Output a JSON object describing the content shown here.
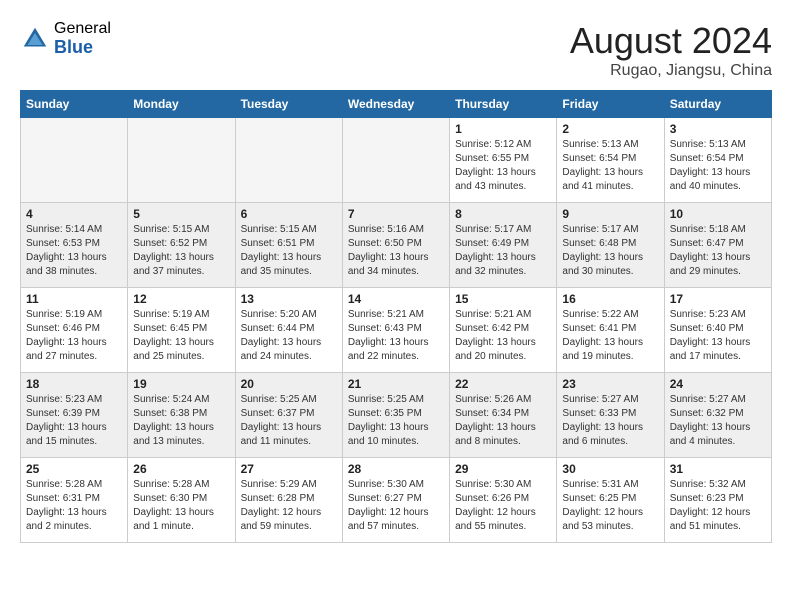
{
  "header": {
    "logo_general": "General",
    "logo_blue": "Blue",
    "month_year": "August 2024",
    "location": "Rugao, Jiangsu, China"
  },
  "calendar": {
    "days_of_week": [
      "Sunday",
      "Monday",
      "Tuesday",
      "Wednesday",
      "Thursday",
      "Friday",
      "Saturday"
    ],
    "weeks": [
      {
        "shaded": false,
        "days": [
          {
            "date": "",
            "info": ""
          },
          {
            "date": "",
            "info": ""
          },
          {
            "date": "",
            "info": ""
          },
          {
            "date": "",
            "info": ""
          },
          {
            "date": "1",
            "info": "Sunrise: 5:12 AM\nSunset: 6:55 PM\nDaylight: 13 hours\nand 43 minutes."
          },
          {
            "date": "2",
            "info": "Sunrise: 5:13 AM\nSunset: 6:54 PM\nDaylight: 13 hours\nand 41 minutes."
          },
          {
            "date": "3",
            "info": "Sunrise: 5:13 AM\nSunset: 6:54 PM\nDaylight: 13 hours\nand 40 minutes."
          }
        ]
      },
      {
        "shaded": true,
        "days": [
          {
            "date": "4",
            "info": "Sunrise: 5:14 AM\nSunset: 6:53 PM\nDaylight: 13 hours\nand 38 minutes."
          },
          {
            "date": "5",
            "info": "Sunrise: 5:15 AM\nSunset: 6:52 PM\nDaylight: 13 hours\nand 37 minutes."
          },
          {
            "date": "6",
            "info": "Sunrise: 5:15 AM\nSunset: 6:51 PM\nDaylight: 13 hours\nand 35 minutes."
          },
          {
            "date": "7",
            "info": "Sunrise: 5:16 AM\nSunset: 6:50 PM\nDaylight: 13 hours\nand 34 minutes."
          },
          {
            "date": "8",
            "info": "Sunrise: 5:17 AM\nSunset: 6:49 PM\nDaylight: 13 hours\nand 32 minutes."
          },
          {
            "date": "9",
            "info": "Sunrise: 5:17 AM\nSunset: 6:48 PM\nDaylight: 13 hours\nand 30 minutes."
          },
          {
            "date": "10",
            "info": "Sunrise: 5:18 AM\nSunset: 6:47 PM\nDaylight: 13 hours\nand 29 minutes."
          }
        ]
      },
      {
        "shaded": false,
        "days": [
          {
            "date": "11",
            "info": "Sunrise: 5:19 AM\nSunset: 6:46 PM\nDaylight: 13 hours\nand 27 minutes."
          },
          {
            "date": "12",
            "info": "Sunrise: 5:19 AM\nSunset: 6:45 PM\nDaylight: 13 hours\nand 25 minutes."
          },
          {
            "date": "13",
            "info": "Sunrise: 5:20 AM\nSunset: 6:44 PM\nDaylight: 13 hours\nand 24 minutes."
          },
          {
            "date": "14",
            "info": "Sunrise: 5:21 AM\nSunset: 6:43 PM\nDaylight: 13 hours\nand 22 minutes."
          },
          {
            "date": "15",
            "info": "Sunrise: 5:21 AM\nSunset: 6:42 PM\nDaylight: 13 hours\nand 20 minutes."
          },
          {
            "date": "16",
            "info": "Sunrise: 5:22 AM\nSunset: 6:41 PM\nDaylight: 13 hours\nand 19 minutes."
          },
          {
            "date": "17",
            "info": "Sunrise: 5:23 AM\nSunset: 6:40 PM\nDaylight: 13 hours\nand 17 minutes."
          }
        ]
      },
      {
        "shaded": true,
        "days": [
          {
            "date": "18",
            "info": "Sunrise: 5:23 AM\nSunset: 6:39 PM\nDaylight: 13 hours\nand 15 minutes."
          },
          {
            "date": "19",
            "info": "Sunrise: 5:24 AM\nSunset: 6:38 PM\nDaylight: 13 hours\nand 13 minutes."
          },
          {
            "date": "20",
            "info": "Sunrise: 5:25 AM\nSunset: 6:37 PM\nDaylight: 13 hours\nand 11 minutes."
          },
          {
            "date": "21",
            "info": "Sunrise: 5:25 AM\nSunset: 6:35 PM\nDaylight: 13 hours\nand 10 minutes."
          },
          {
            "date": "22",
            "info": "Sunrise: 5:26 AM\nSunset: 6:34 PM\nDaylight: 13 hours\nand 8 minutes."
          },
          {
            "date": "23",
            "info": "Sunrise: 5:27 AM\nSunset: 6:33 PM\nDaylight: 13 hours\nand 6 minutes."
          },
          {
            "date": "24",
            "info": "Sunrise: 5:27 AM\nSunset: 6:32 PM\nDaylight: 13 hours\nand 4 minutes."
          }
        ]
      },
      {
        "shaded": false,
        "days": [
          {
            "date": "25",
            "info": "Sunrise: 5:28 AM\nSunset: 6:31 PM\nDaylight: 13 hours\nand 2 minutes."
          },
          {
            "date": "26",
            "info": "Sunrise: 5:28 AM\nSunset: 6:30 PM\nDaylight: 13 hours\nand 1 minute."
          },
          {
            "date": "27",
            "info": "Sunrise: 5:29 AM\nSunset: 6:28 PM\nDaylight: 12 hours\nand 59 minutes."
          },
          {
            "date": "28",
            "info": "Sunrise: 5:30 AM\nSunset: 6:27 PM\nDaylight: 12 hours\nand 57 minutes."
          },
          {
            "date": "29",
            "info": "Sunrise: 5:30 AM\nSunset: 6:26 PM\nDaylight: 12 hours\nand 55 minutes."
          },
          {
            "date": "30",
            "info": "Sunrise: 5:31 AM\nSunset: 6:25 PM\nDaylight: 12 hours\nand 53 minutes."
          },
          {
            "date": "31",
            "info": "Sunrise: 5:32 AM\nSunset: 6:23 PM\nDaylight: 12 hours\nand 51 minutes."
          }
        ]
      }
    ]
  }
}
